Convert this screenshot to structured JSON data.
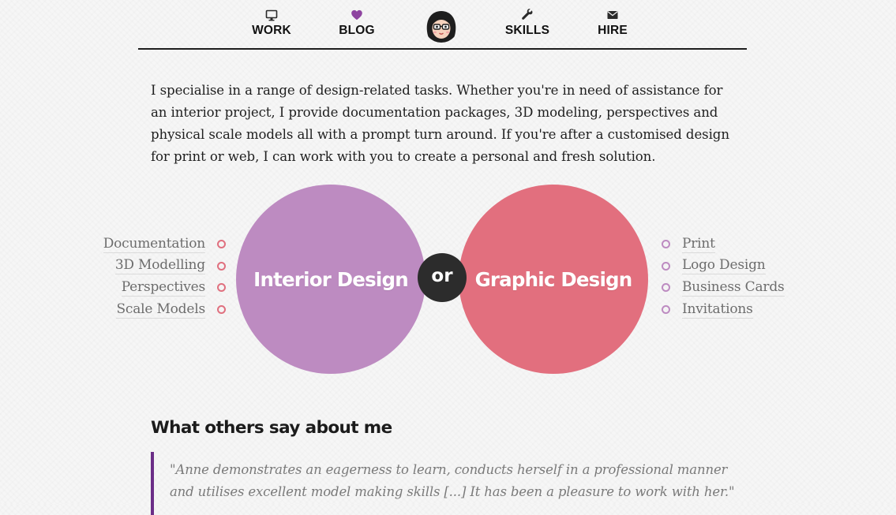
{
  "nav": {
    "items": [
      {
        "label": "WORK",
        "icon": "monitor-icon"
      },
      {
        "label": "BLOG",
        "icon": "heart-icon"
      },
      {
        "label": "SKILLS",
        "icon": "wrench-icon"
      },
      {
        "label": "HIRE",
        "icon": "envelope-icon"
      }
    ],
    "avatar": "avatar-illustration"
  },
  "intro": {
    "text": "I specialise in a range of design-related tasks. Whether you're in need of assistance for an interior project, I provide documentation packages, 3D modeling, perspectives and physical scale models all with a prompt turn around. If you're after a customised design for print or web, I can work with you to create a personal and fresh solution."
  },
  "services": {
    "interior": {
      "title": "Interior Design",
      "color": "#bd8bc1",
      "items": [
        "Documentation",
        "3D Modelling",
        "Perspectives",
        "Scale Models"
      ]
    },
    "divider": "or",
    "graphic": {
      "title": "Graphic Design",
      "color": "#e26f7e",
      "items": [
        "Print",
        "Logo Design",
        "Business Cards",
        "Invitations"
      ]
    }
  },
  "testimonials": {
    "heading": "What others say about me",
    "quote": "\"Anne demonstrates an eagerness to learn, conducts herself in a professional manner and utilises excellent model making skills [...] It has been a pleasure to work with her.\"",
    "accent": "#6b2e87"
  }
}
